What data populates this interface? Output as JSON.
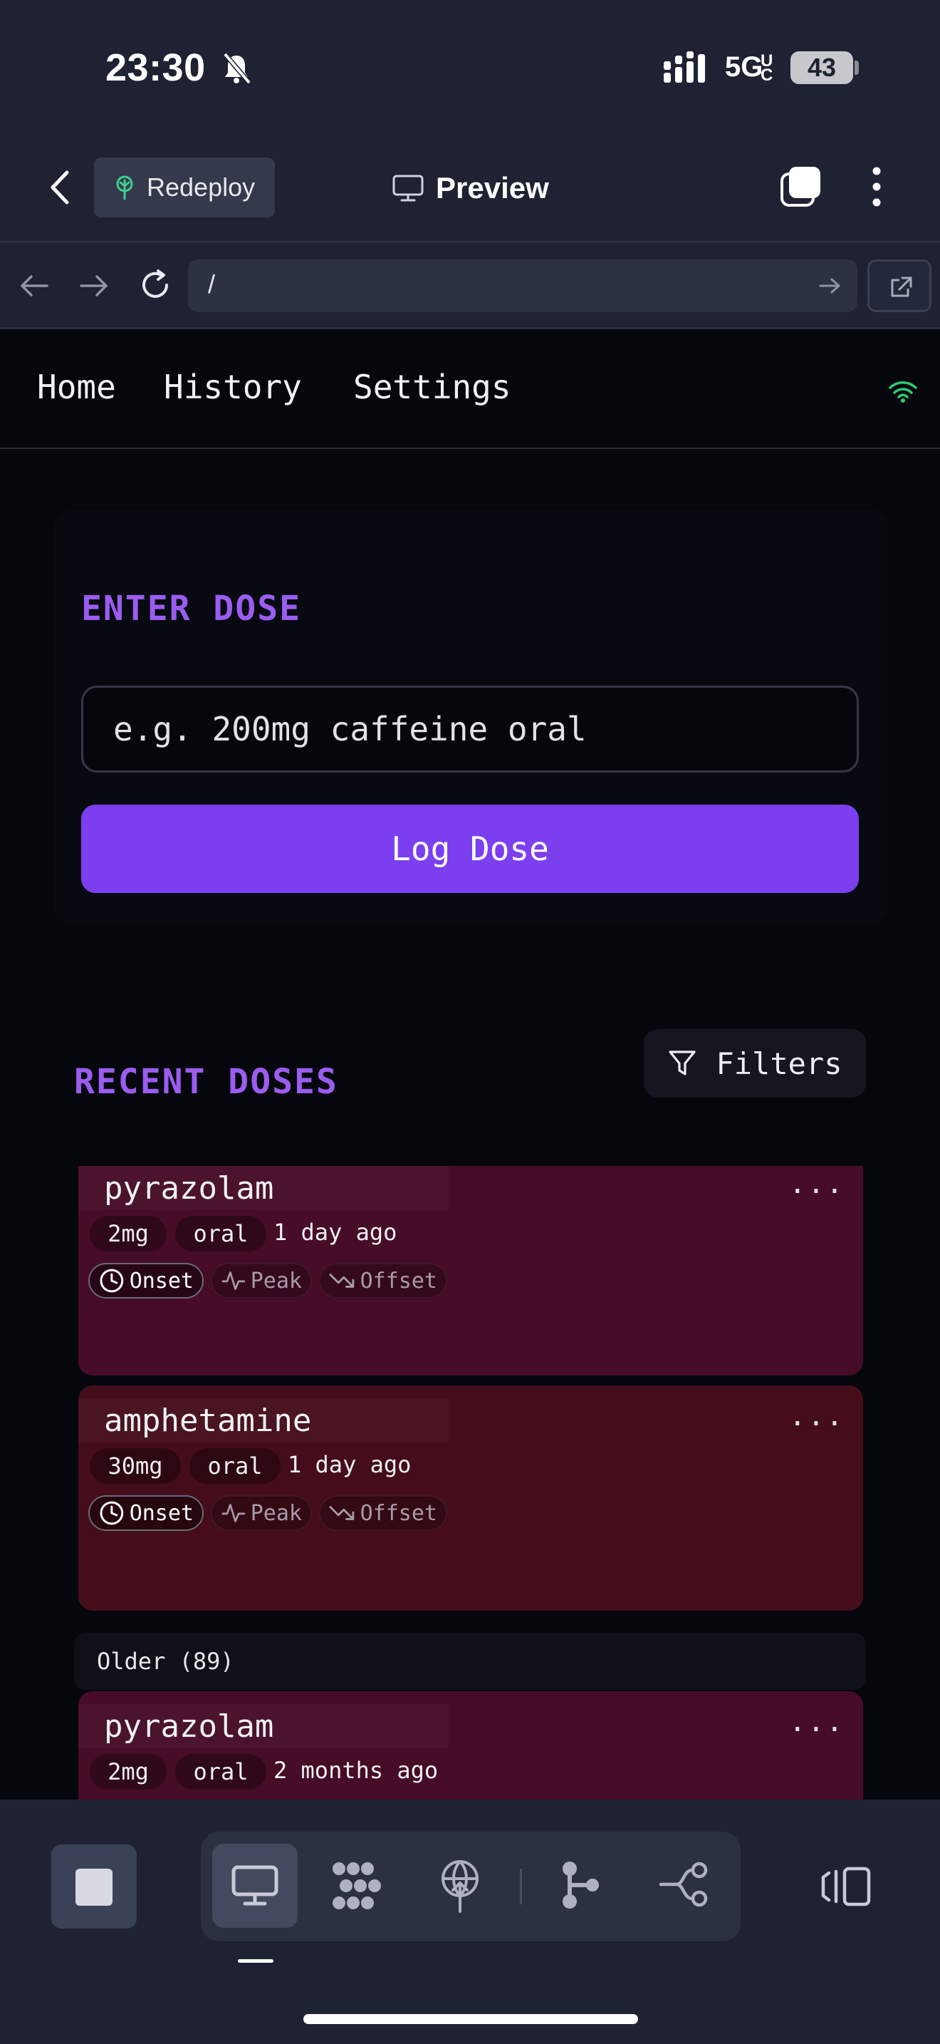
{
  "status_bar": {
    "time": "23:30",
    "network": "5G",
    "battery": "43"
  },
  "toolbar": {
    "redeploy_label": "Redeploy",
    "preview_label": "Preview"
  },
  "url_bar": {
    "url": "/"
  },
  "nav": {
    "home": "Home",
    "history": "History",
    "settings": "Settings"
  },
  "dose_form": {
    "title": "ENTER DOSE",
    "input_placeholder": "e.g. 200mg caffeine oral",
    "input_value": "",
    "submit_label": "Log Dose"
  },
  "recent": {
    "title": "RECENT DOSES",
    "filters_label": "Filters",
    "phase_labels": {
      "onset": "Onset",
      "peak": "Peak",
      "offset": "Offset"
    },
    "more_label": "...",
    "entries": [
      {
        "substance": "pyrazolam",
        "amount": "2mg",
        "route": "oral",
        "time_ago": "1 day ago",
        "color": "#460c28"
      },
      {
        "substance": "amphetamine",
        "amount": "30mg",
        "route": "oral",
        "time_ago": "1 day ago",
        "color": "#450d1a"
      }
    ],
    "older_label": "Older (89)",
    "older_entries": [
      {
        "substance": "pyrazolam",
        "amount": "2mg",
        "route": "oral",
        "time_ago": "2 months ago",
        "color": "#460c28"
      }
    ]
  },
  "colors": {
    "accent": "#9b5cf0",
    "button": "#7b3ff0",
    "online": "#2ecc71"
  }
}
